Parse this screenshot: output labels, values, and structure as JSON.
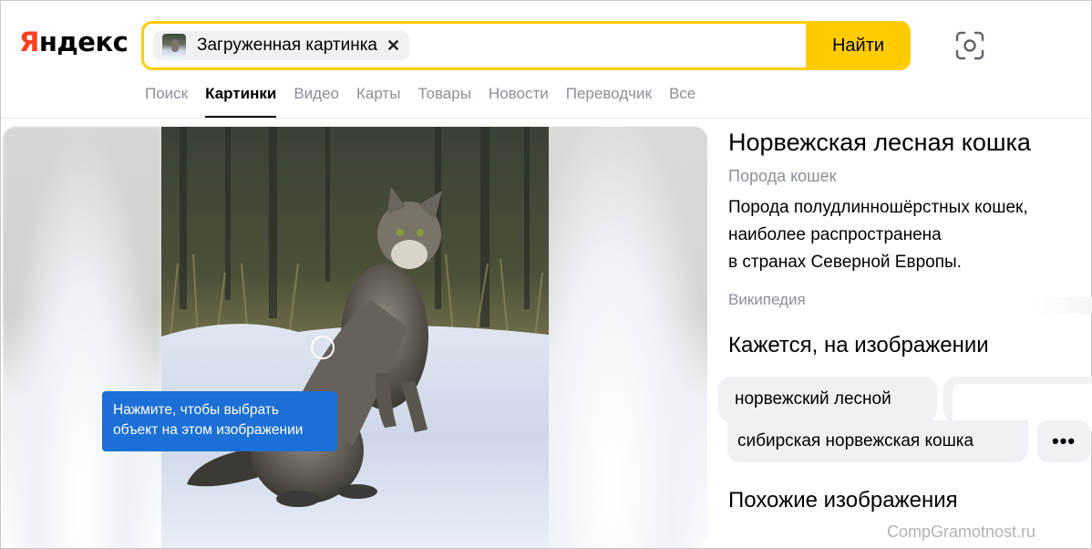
{
  "logo": {
    "first_letter": "Я",
    "rest": "ндекс"
  },
  "search": {
    "chip_label": "Загруженная картинка",
    "chip_close": "✕",
    "submit_label": "Найти"
  },
  "tabs": [
    {
      "label": "Поиск",
      "active": false
    },
    {
      "label": "Картинки",
      "active": true
    },
    {
      "label": "Видео",
      "active": false
    },
    {
      "label": "Карты",
      "active": false
    },
    {
      "label": "Товары",
      "active": false
    },
    {
      "label": "Новости",
      "active": false
    },
    {
      "label": "Переводчик",
      "active": false
    },
    {
      "label": "Все",
      "active": false
    }
  ],
  "viewer": {
    "tooltip_line1": "Нажмите, чтобы выбрать",
    "tooltip_line2": "объект на этом изображении"
  },
  "info": {
    "title": "Норвежская лесная кошка",
    "subtitle": "Порода кошек",
    "desc_line1": "Порода полудлинношёрстных кошек,",
    "desc_line2": "наиболее распространена",
    "desc_line3": "в странах Северной Европы.",
    "source": "Википедия"
  },
  "recognized": {
    "heading": "Кажется, на изображении",
    "tags": [
      "норвежский лесной",
      "сибирская норвежская кошка"
    ],
    "more_label": "•••"
  },
  "similar": {
    "heading": "Похожие изображения"
  },
  "watermark": "CompGramotnost.ru",
  "colors": {
    "brand_red": "#fc3f1d",
    "search_yellow": "#ffcc00",
    "tooltip_blue": "#1b6fd6",
    "muted_gray": "#8a8f99"
  }
}
